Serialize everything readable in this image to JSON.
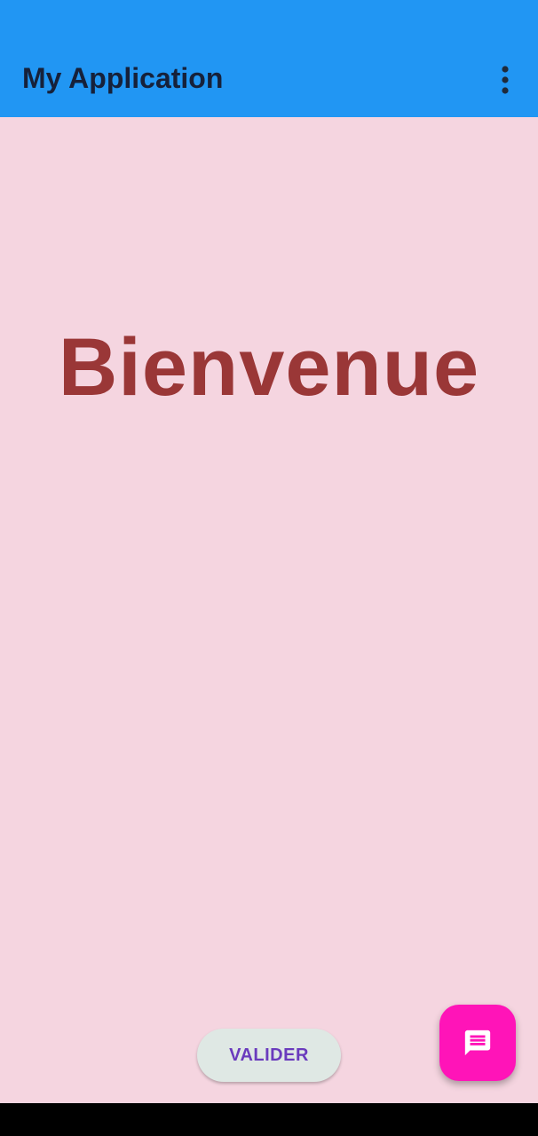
{
  "app_bar": {
    "title": "My Application",
    "menu_icon": "more-vert-icon",
    "color": "#2196f3"
  },
  "main": {
    "welcome_text": "Bienvenue",
    "background_color": "#f5d5e0",
    "welcome_color": "#9a3737"
  },
  "buttons": {
    "validate_label": "VALIDER",
    "fab_icon": "message-icon",
    "fab_color": "#ff14b8"
  }
}
